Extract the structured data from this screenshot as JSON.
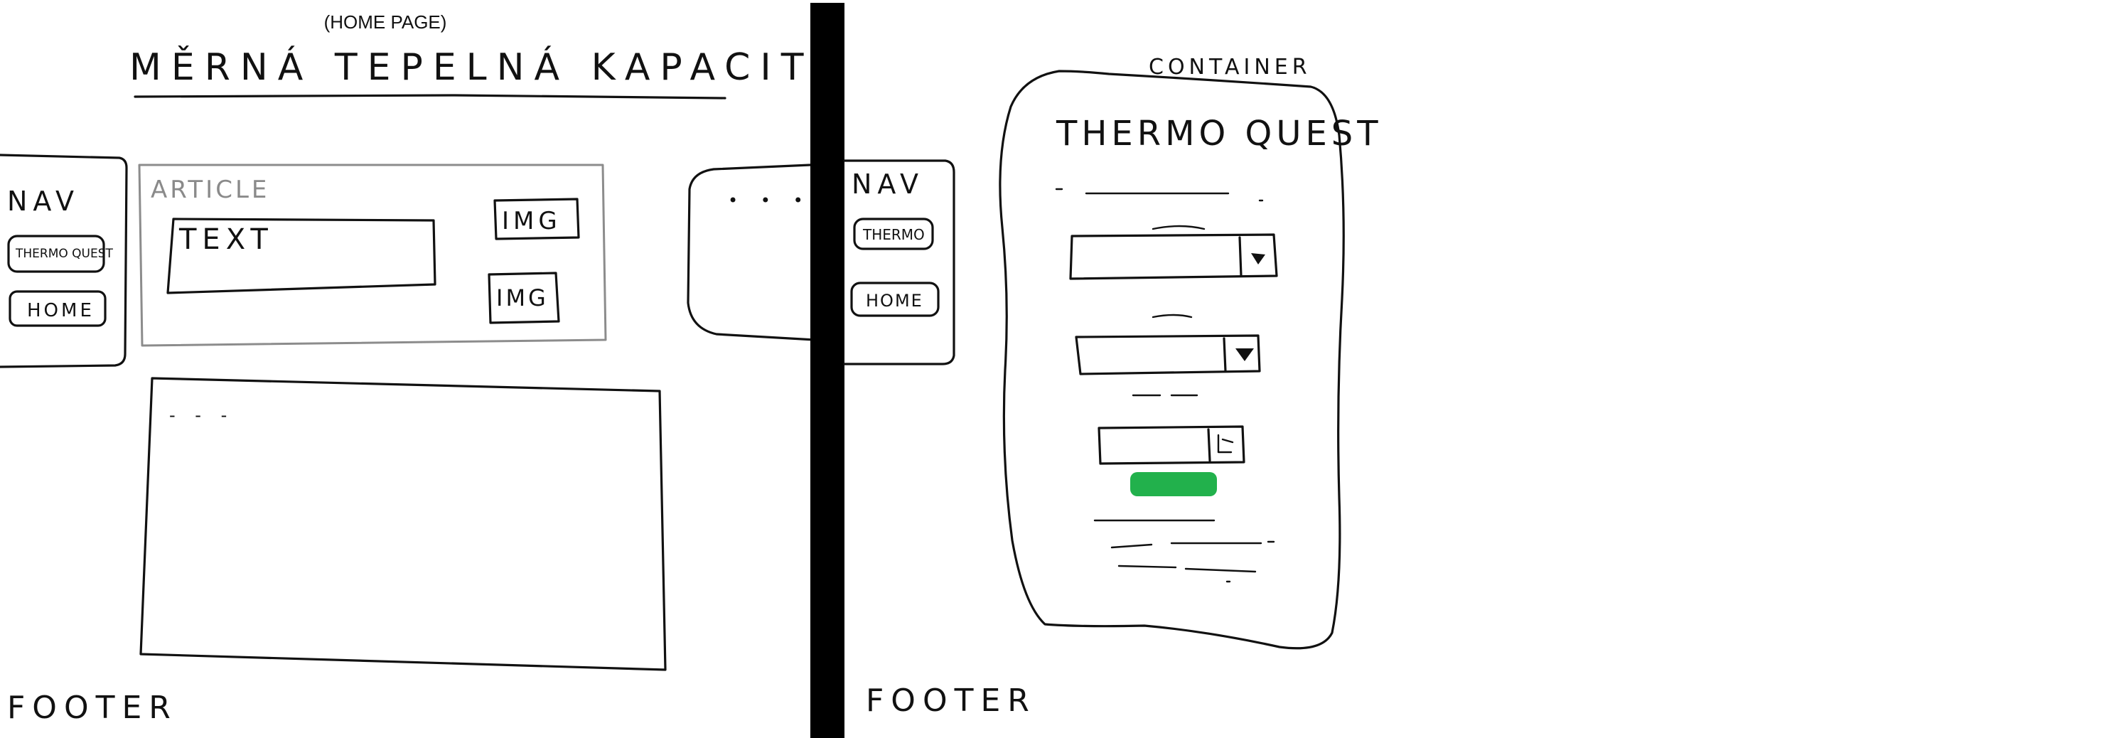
{
  "colors": {
    "ink": "#111111",
    "article_grey": "#8c8c8c",
    "divider": "#000000",
    "submit_button": "#22b14c"
  },
  "left_page": {
    "page_label": "(HOME PAGE)",
    "title": "MĚRNÁ TEPELNÁ KAPACITA",
    "nav": {
      "label": "NAV",
      "buttons": [
        "THERMO QUEST",
        "HOME"
      ]
    },
    "article": {
      "label": "ARTICLE",
      "text_box": "TEXT",
      "images": [
        "IMG",
        "IMG"
      ]
    },
    "content_box_placeholder": "- - -",
    "side_box_dots": "• • •",
    "footer": "FOOTER"
  },
  "right_page": {
    "container_label": "CONTAINER",
    "title": "THERMO QUEST",
    "nav": {
      "label": "NAV",
      "buttons": [
        "THERMO",
        "HOME"
      ]
    },
    "dropdown_icons": [
      "dropdown-arrow-icon",
      "dropdown-arrow-icon",
      "stepper-icon"
    ],
    "footer": "FOOTER"
  }
}
